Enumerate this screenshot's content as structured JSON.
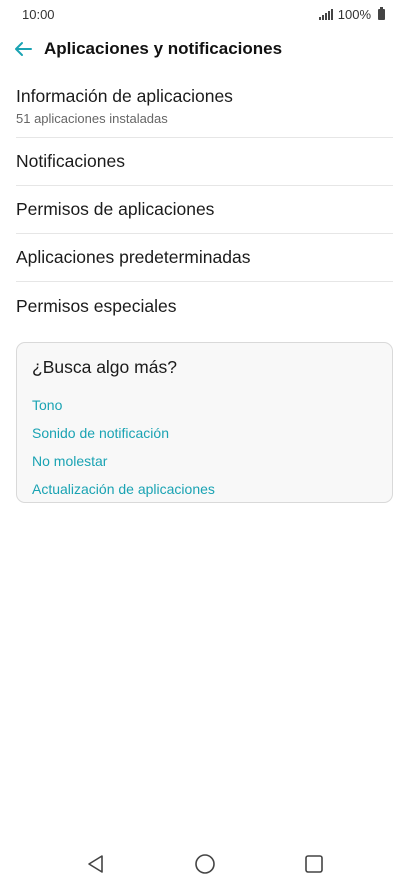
{
  "status_bar": {
    "time": "10:00",
    "battery_text": "100%"
  },
  "header": {
    "title": "Aplicaciones y notificaciones",
    "back_icon": "arrow-left-icon",
    "accent_color": "#1aa3b3"
  },
  "list": {
    "app_info": {
      "title": "Información de aplicaciones",
      "subtitle": "51 aplicaciones instaladas"
    },
    "items": [
      {
        "label": "Notificaciones"
      },
      {
        "label": "Permisos de aplicaciones"
      },
      {
        "label": "Aplicaciones predeterminadas"
      },
      {
        "label": "Permisos especiales"
      }
    ]
  },
  "suggestions": {
    "title": "¿Busca algo más?",
    "links": [
      {
        "label": "Tono"
      },
      {
        "label": "Sonido de notificación"
      },
      {
        "label": "No molestar"
      },
      {
        "label": "Actualización de aplicaciones"
      }
    ]
  },
  "nav_bar": {
    "back": "triangle-back-icon",
    "home": "circle-home-icon",
    "recents": "square-recents-icon"
  }
}
